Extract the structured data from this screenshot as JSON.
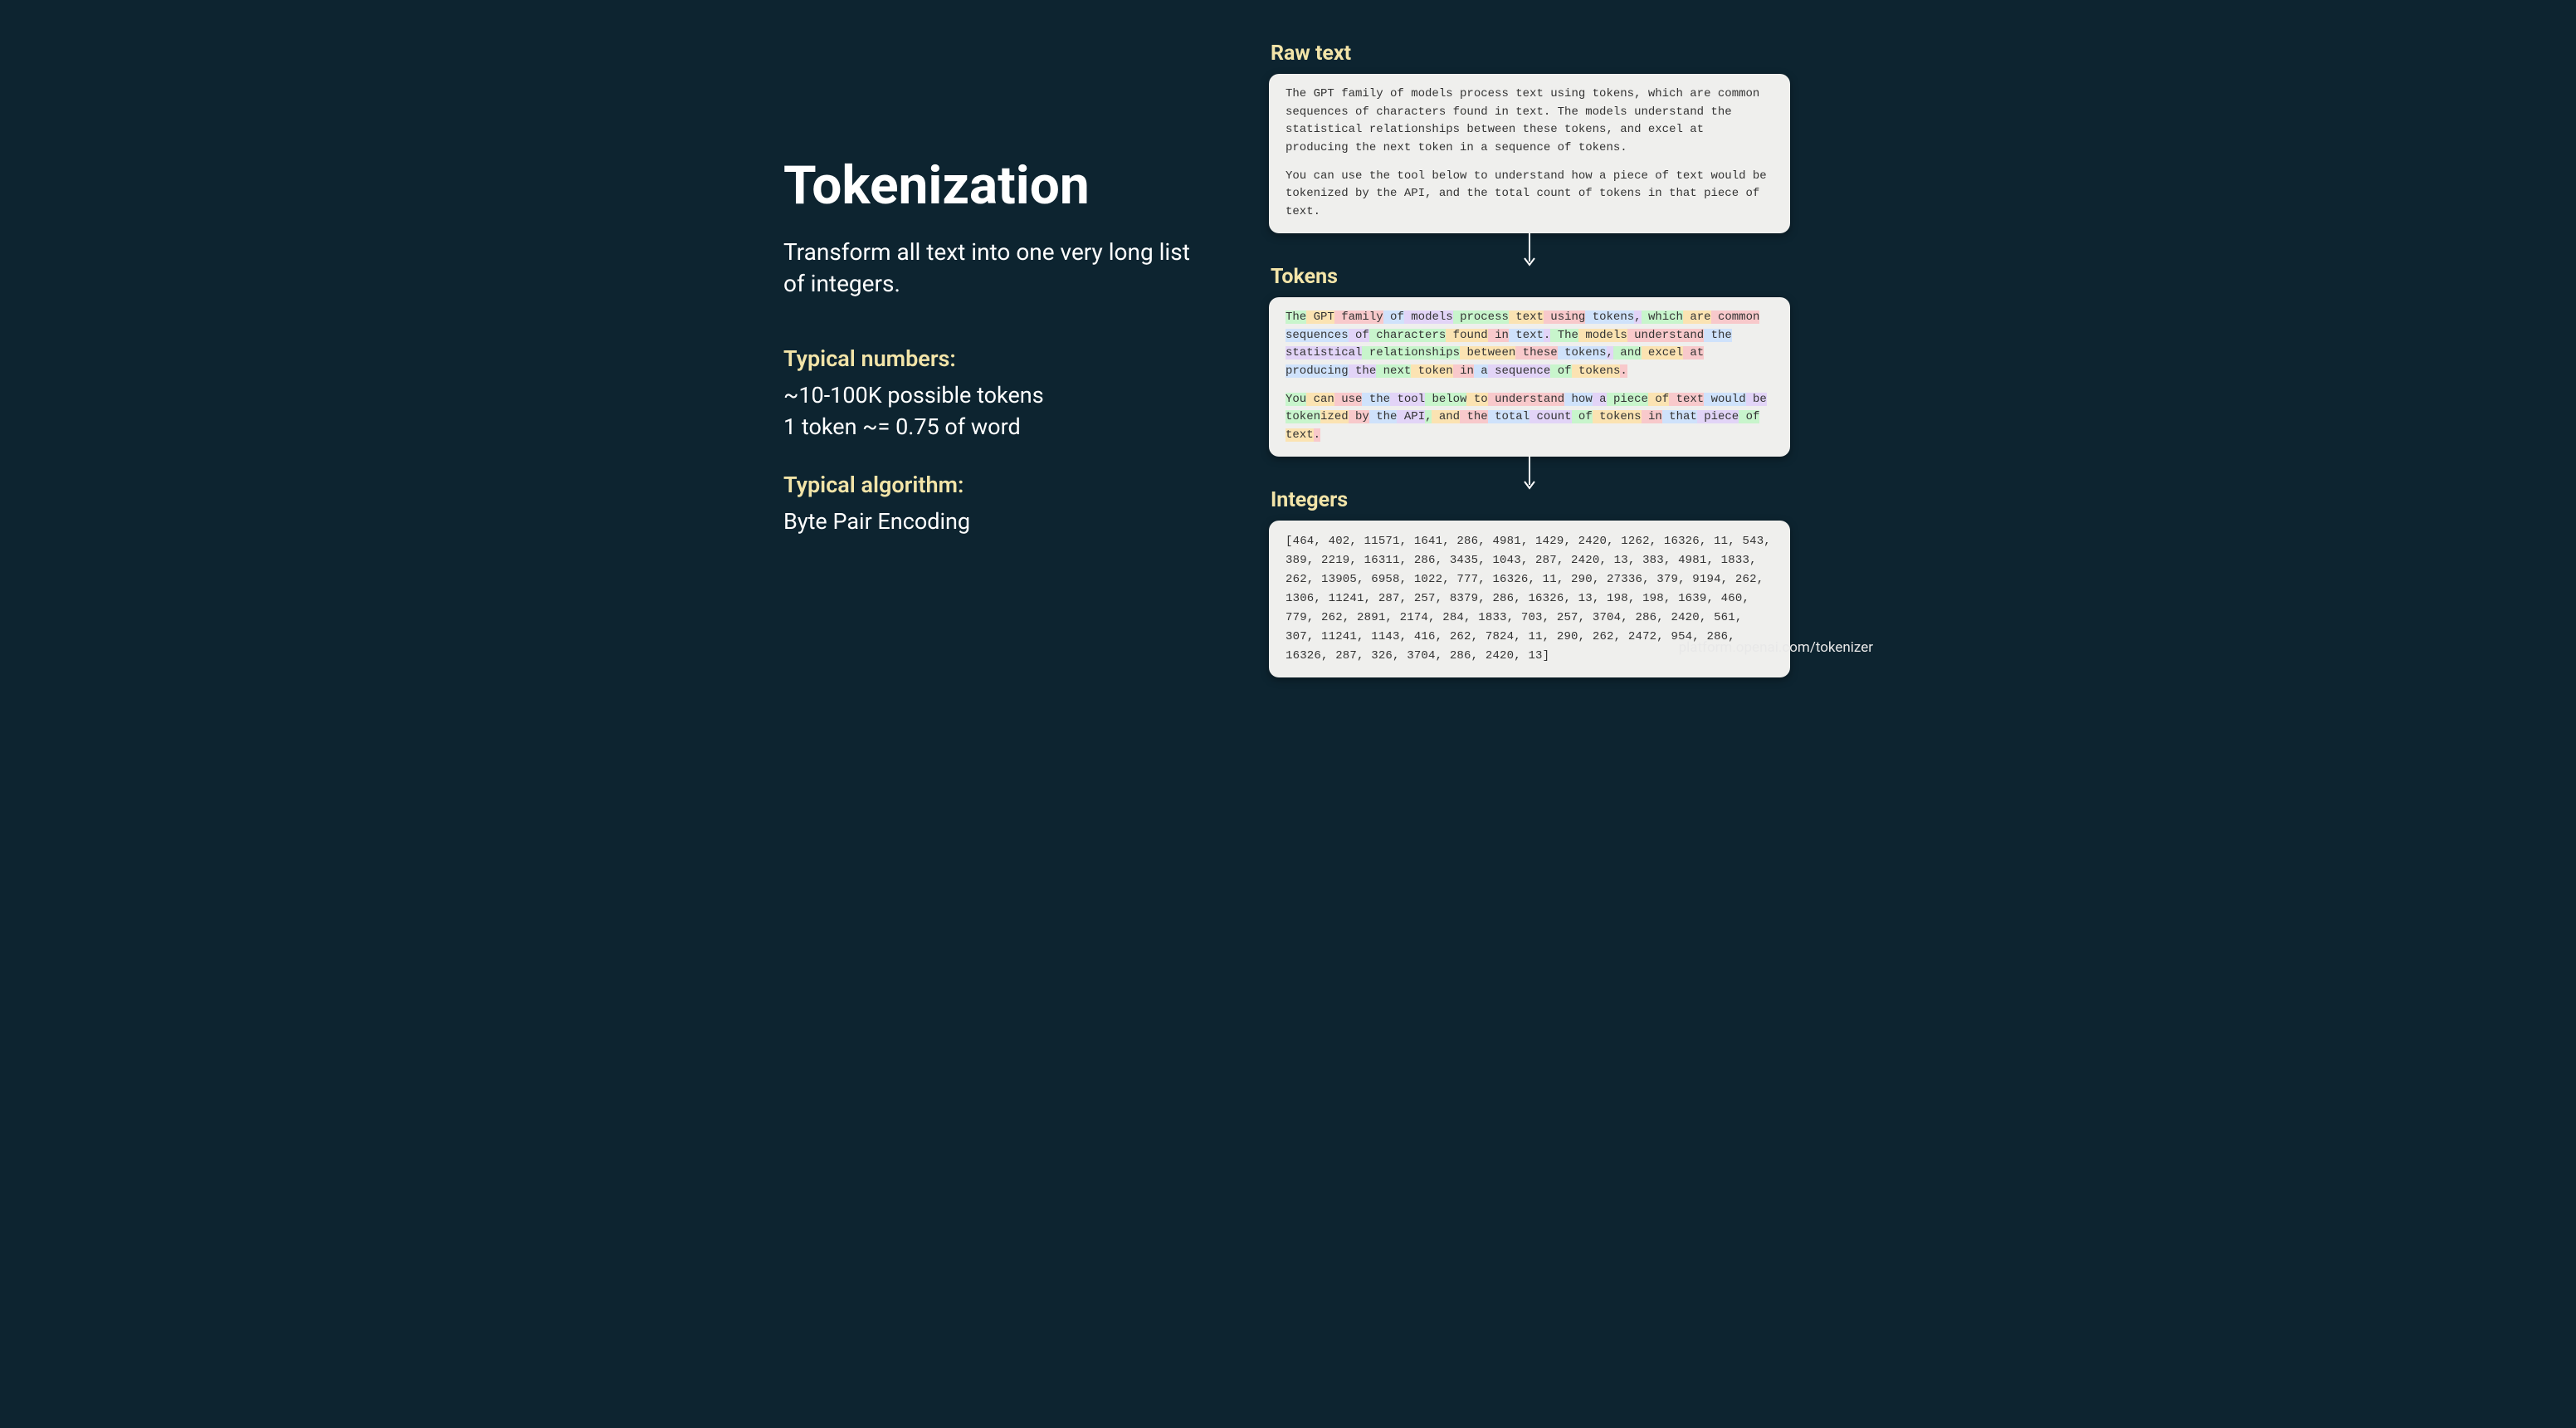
{
  "title": "Tokenization",
  "subtitle": "Transform all text into one very long list of integers.",
  "sections": {
    "numbers_head": "Typical numbers:",
    "numbers_line1": "~10-100K possible tokens",
    "numbers_line2": "1 token ~= 0.75 of word",
    "algorithm_head": "Typical algorithm:",
    "algorithm_line1": "Byte Pair Encoding"
  },
  "panels": {
    "raw_label": "Raw text",
    "tokens_label": "Tokens",
    "integers_label": "Integers",
    "raw_para1": "The GPT family of models process text using tokens, which are common sequences of characters found in text. The models understand the statistical relationships between these tokens, and excel at producing the next token in a sequence of tokens.",
    "raw_para2": "You can use the tool below to understand how a piece of text would be tokenized by the API, and the total count of tokens in that piece of text.",
    "tokens_para1": [
      "The",
      " GPT",
      " family",
      " of",
      " models",
      " process",
      " text",
      " using",
      " tokens",
      ",",
      " which",
      " are",
      " common",
      " sequences",
      " of",
      " characters",
      " found",
      " in",
      " text",
      ".",
      " The",
      " models",
      " understand",
      " the",
      " statistical",
      " relationships",
      " between",
      " these",
      " tokens",
      ",",
      " and",
      " excel",
      " at",
      " producing",
      " the",
      " next",
      " token",
      " in",
      " a",
      " sequence",
      " of",
      " tokens",
      "."
    ],
    "tokens_para2": [
      "You",
      " can",
      " use",
      " the",
      " tool",
      " below",
      " to",
      " understand",
      " how",
      " a",
      " piece",
      " of",
      " text",
      " would",
      " be",
      " token",
      "ized",
      " by",
      " the",
      " API",
      ",",
      " and",
      " the",
      " total",
      " count",
      " of",
      " tokens",
      " in",
      " that",
      " piece",
      " of",
      " text",
      "."
    ],
    "integers_text": "[464, 402, 11571, 1641, 286, 4981, 1429, 2420, 1262, 16326, 11, 543, 389, 2219, 16311, 286, 3435, 1043, 287, 2420, 13, 383, 4981, 1833, 262, 13905, 6958, 1022, 777, 16326, 11, 290, 27336, 379, 9194, 262, 1306, 11241, 287, 257, 8379, 286, 16326, 13, 198, 198, 1639, 460, 779, 262, 2891, 2174, 284, 1833, 703, 257, 3704, 286, 2420, 561, 307, 11241, 1143, 416, 262, 7824, 11, 290, 262, 2472, 954, 286, 16326, 287, 326, 3704, 286, 2420, 13]"
  },
  "footer": "platform.openai.com/tokenizer",
  "colors": {
    "bg": "#0d2430",
    "accent": "#f2e4a8",
    "panel_bg": "#efefed"
  }
}
